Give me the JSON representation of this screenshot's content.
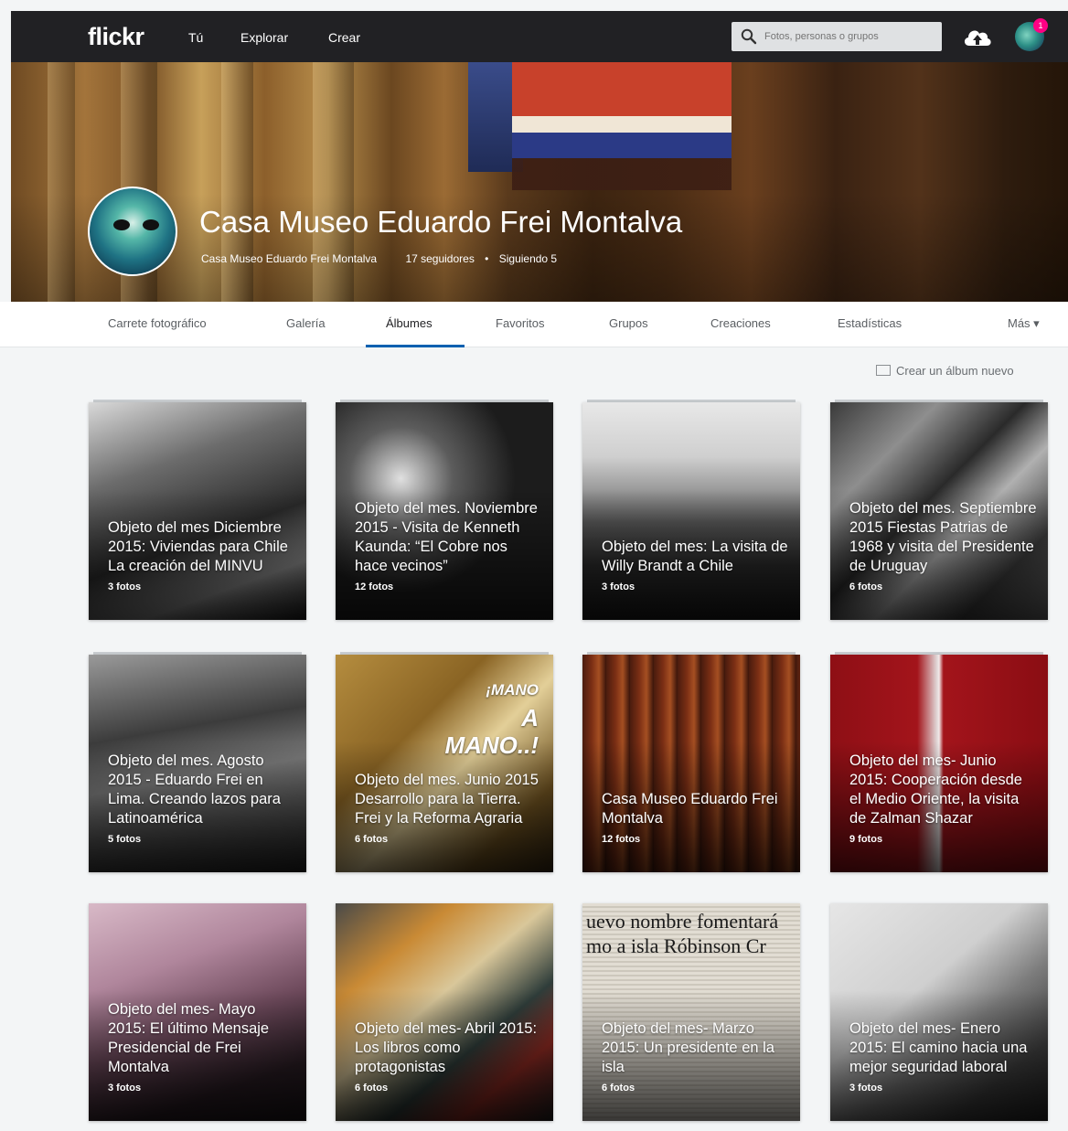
{
  "topbar": {
    "logo": "flickr",
    "nav": [
      "Tú",
      "Explorar",
      "Crear"
    ],
    "search_placeholder": "Fotos, personas o grupos",
    "notification_count": "1"
  },
  "cover": {
    "title": "Casa Museo Eduardo Frei Montalva",
    "owner": "Casa Museo Eduardo Frei Montalva",
    "followers": "17 seguidores",
    "separator": "•",
    "following": "Siguiendo 5"
  },
  "tabs": [
    "Carrete fotográfico",
    "Galería",
    "Álbumes",
    "Favoritos",
    "Grupos",
    "Creaciones",
    "Estadísticas",
    "Más ▾"
  ],
  "create_album": "Crear un álbum nuevo",
  "albums": [
    {
      "title": "Objeto del mes Diciembre 2015: Viviendas para Chile La creación del MINVU",
      "count": "3 fotos"
    },
    {
      "title": "Objeto del mes. Noviembre 2015 - Visita de Kenneth Kaunda: “El Cobre nos hace vecinos”",
      "count": "12 fotos"
    },
    {
      "title": "Objeto del mes: La visita de Willy Brandt a Chile",
      "count": "3 fotos"
    },
    {
      "title": "Objeto del mes. Septiembre 2015 Fiestas Patrias de 1968 y visita del Presidente de Uruguay",
      "count": "6 fotos"
    },
    {
      "title": "Objeto del mes. Agosto 2015 - Eduardo Frei en Lima. Creando lazos para Latinoamérica",
      "count": "5 fotos"
    },
    {
      "title": "Objeto del mes. Junio 2015 Desarrollo para la Tierra. Frei y la Reforma Agraria",
      "count": "6 fotos"
    },
    {
      "title": "Casa Museo Eduardo Frei Montalva",
      "count": "12 fotos"
    },
    {
      "title": "Objeto del mes- Junio 2015: Cooperación desde el Medio Oriente, la visita de Zalman Shazar",
      "count": "9 fotos"
    },
    {
      "title": "Objeto del mes- Mayo 2015: El último Mensaje Presidencial de Frei Montalva",
      "count": "3 fotos"
    },
    {
      "title": "Objeto del mes- Abril 2015: Los libros como protagonistas",
      "count": "6 fotos"
    },
    {
      "title": "Objeto del mes- Marzo 2015: Un presidente en la isla",
      "count": "6 fotos"
    },
    {
      "title": "Objeto del mes- Enero 2015: El camino hacia una mejor seguridad laboral",
      "count": "3 fotos"
    }
  ],
  "poster": {
    "line1": "¡MANO",
    "line2": "A",
    "line3": "MANO..!"
  },
  "newspaper": {
    "line1": "uevo nombre fomentará",
    "line2": "mo a isla Róbinson Cr"
  }
}
